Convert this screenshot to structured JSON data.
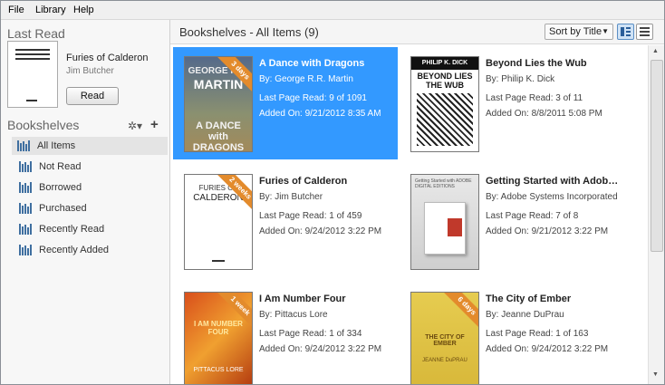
{
  "menu": [
    "File",
    "Library",
    "Help"
  ],
  "last_read": {
    "heading": "Last Read",
    "title": "Furies of Calderon",
    "author": "Jim Butcher",
    "button": "Read"
  },
  "bookshelves": {
    "heading": "Bookshelves",
    "items": [
      {
        "label": "All Items"
      },
      {
        "label": "Not Read"
      },
      {
        "label": "Borrowed"
      },
      {
        "label": "Purchased"
      },
      {
        "label": "Recently Read"
      },
      {
        "label": "Recently Added"
      }
    ]
  },
  "main": {
    "title": "Bookshelves - All Items (9)",
    "sort_label": "Sort by Title"
  },
  "books": [
    {
      "title": "A Dance with Dragons",
      "by": "By:  George R.R. Martin",
      "pages": "Last Page Read:  9 of 1091",
      "added": "Added On:  9/21/2012 8:35 AM",
      "ribbon": "3 days",
      "cover_text_top": "GEORGE R.R.",
      "cover_text_mid": "MARTIN",
      "cover_text_bottom": "A DANCE with DRAGONS"
    },
    {
      "title": "Beyond Lies the Wub",
      "by": "By:  Philip K. Dick",
      "pages": "Last Page Read:  3 of 11",
      "added": "Added On:  8/8/2011 5:08 PM",
      "ribbon": "",
      "cover_text_top": "PHILIP K. DICK",
      "cover_text_mid": "BEYOND LIES THE WUB",
      "cover_text_bottom": ""
    },
    {
      "title": "Furies of Calderon",
      "by": "By:  Jim Butcher",
      "pages": "Last Page Read:  1 of 459",
      "added": "Added On:  9/24/2012 3:22 PM",
      "ribbon": "2 weeks",
      "cover_text_top": "FURIES OF",
      "cover_text_mid": "CALDERON",
      "cover_text_bottom": ""
    },
    {
      "title": "Getting Started with Adobe D...",
      "by": "By:  Adobe Systems Incorporated",
      "pages": "Last Page Read:  7 of 8",
      "added": "Added On:  9/21/2012 3:22 PM",
      "ribbon": "",
      "cover_text_top": "Getting Started with ADOBE DIGITAL EDITIONS",
      "cover_text_mid": "",
      "cover_text_bottom": ""
    },
    {
      "title": "I Am Number Four",
      "by": "By:  Pittacus Lore",
      "pages": "Last Page Read:  1 of 334",
      "added": "Added On:  9/24/2012 3:22 PM",
      "ribbon": "1 week",
      "cover_text_top": "I AM NUMBER FOUR",
      "cover_text_mid": "PITTACUS LORE",
      "cover_text_bottom": ""
    },
    {
      "title": "The City of Ember",
      "by": "By:  Jeanne DuPrau",
      "pages": "Last Page Read:  1 of 163",
      "added": "Added On:  9/24/2012 3:22 PM",
      "ribbon": "6 days",
      "cover_text_top": "THE CITY OF EMBER",
      "cover_text_mid": "JEANNE DuPRAU",
      "cover_text_bottom": ""
    }
  ],
  "colors": {
    "selection": "#3399ff",
    "ribbon": "#e38b2c",
    "accent": "#3f6fa0"
  },
  "icons": [
    "gear-icon",
    "add-icon",
    "bookshelf-icon",
    "sort-dropdown-icon",
    "grid-view-icon",
    "list-view-icon"
  ]
}
